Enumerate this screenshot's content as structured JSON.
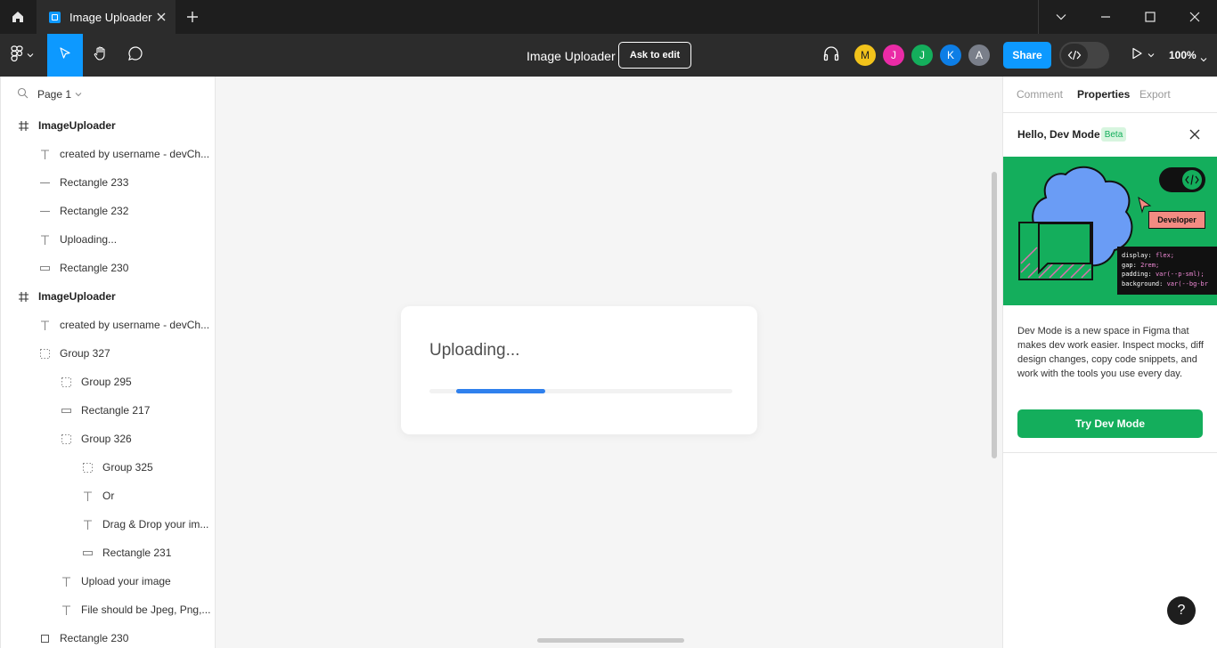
{
  "titlebar": {
    "tab_title": "Image Uploader",
    "icons": [
      "home-icon",
      "file-icon",
      "close-icon",
      "plus-icon",
      "chevron-down-icon",
      "minimize-icon",
      "maximize-icon",
      "window-close-icon"
    ]
  },
  "toolbar": {
    "file_title": "Image Uploader",
    "ask_to_edit": "Ask to edit",
    "avatars": [
      {
        "initial": "M",
        "color": "#f2c31b"
      },
      {
        "initial": "J",
        "color": "#ea2ba6"
      },
      {
        "initial": "J",
        "color": "#14ae5c"
      },
      {
        "initial": "K",
        "color": "#0d7ee6"
      },
      {
        "initial": "A",
        "color": "#7a7f8a"
      }
    ],
    "share_label": "Share",
    "zoom": "100%",
    "accent": "#0d99ff"
  },
  "left_panel": {
    "page": "Page 1",
    "layers": [
      {
        "label": "ImageUploader",
        "icon": "frame-icon"
      },
      {
        "label": "created by username - devCh...",
        "icon": "text-icon"
      },
      {
        "label": "Rectangle 233",
        "icon": "line-icon"
      },
      {
        "label": "Rectangle 232",
        "icon": "line-icon"
      },
      {
        "label": "Uploading...",
        "icon": "text-icon"
      },
      {
        "label": "Rectangle 230",
        "icon": "rectangle-icon"
      },
      {
        "label": "ImageUploader",
        "icon": "frame-icon"
      },
      {
        "label": "created by username - devCh...",
        "icon": "text-icon"
      },
      {
        "label": "Group 327",
        "icon": "group-icon"
      },
      {
        "label": "Group 295",
        "icon": "group-icon"
      },
      {
        "label": "Rectangle 217",
        "icon": "rectangle-icon"
      },
      {
        "label": "Group 326",
        "icon": "group-icon"
      },
      {
        "label": "Group 325",
        "icon": "group-icon"
      },
      {
        "label": "Or",
        "icon": "text-icon"
      },
      {
        "label": "Drag & Drop your im...",
        "icon": "text-icon"
      },
      {
        "label": "Rectangle 231",
        "icon": "rectangle-icon"
      },
      {
        "label": "Upload your image",
        "icon": "text-icon"
      },
      {
        "label": "File should be Jpeg, Png,...",
        "icon": "text-icon"
      },
      {
        "label": "Rectangle 230",
        "icon": "rectangle-icon"
      }
    ]
  },
  "canvas": {
    "upload_title": "Uploading...",
    "progress": {
      "start": 0.088,
      "end": 0.382,
      "color": "#2f80ed"
    }
  },
  "right_panel": {
    "tabs": [
      "Comment",
      "Properties",
      "Export"
    ],
    "active_tab": "Properties",
    "dev_mode_title": "Hello, Dev Mode",
    "beta_label": "Beta",
    "promo": {
      "developer_label": "Developer",
      "code_lines": [
        {
          "prop": "display",
          "value": "flex;"
        },
        {
          "prop": "gap",
          "value": "2rem;"
        },
        {
          "prop": "padding",
          "value": "var(--p-sml);"
        },
        {
          "prop": "background",
          "value": "var(--bg-br"
        }
      ]
    },
    "description": "Dev Mode is a new space in Figma that makes dev work easier. Inspect mocks, diff design changes, copy code snippets, and work with the tools you use every day.",
    "try_button": "Try Dev Mode",
    "help": "?",
    "green": "#14ae5c"
  }
}
